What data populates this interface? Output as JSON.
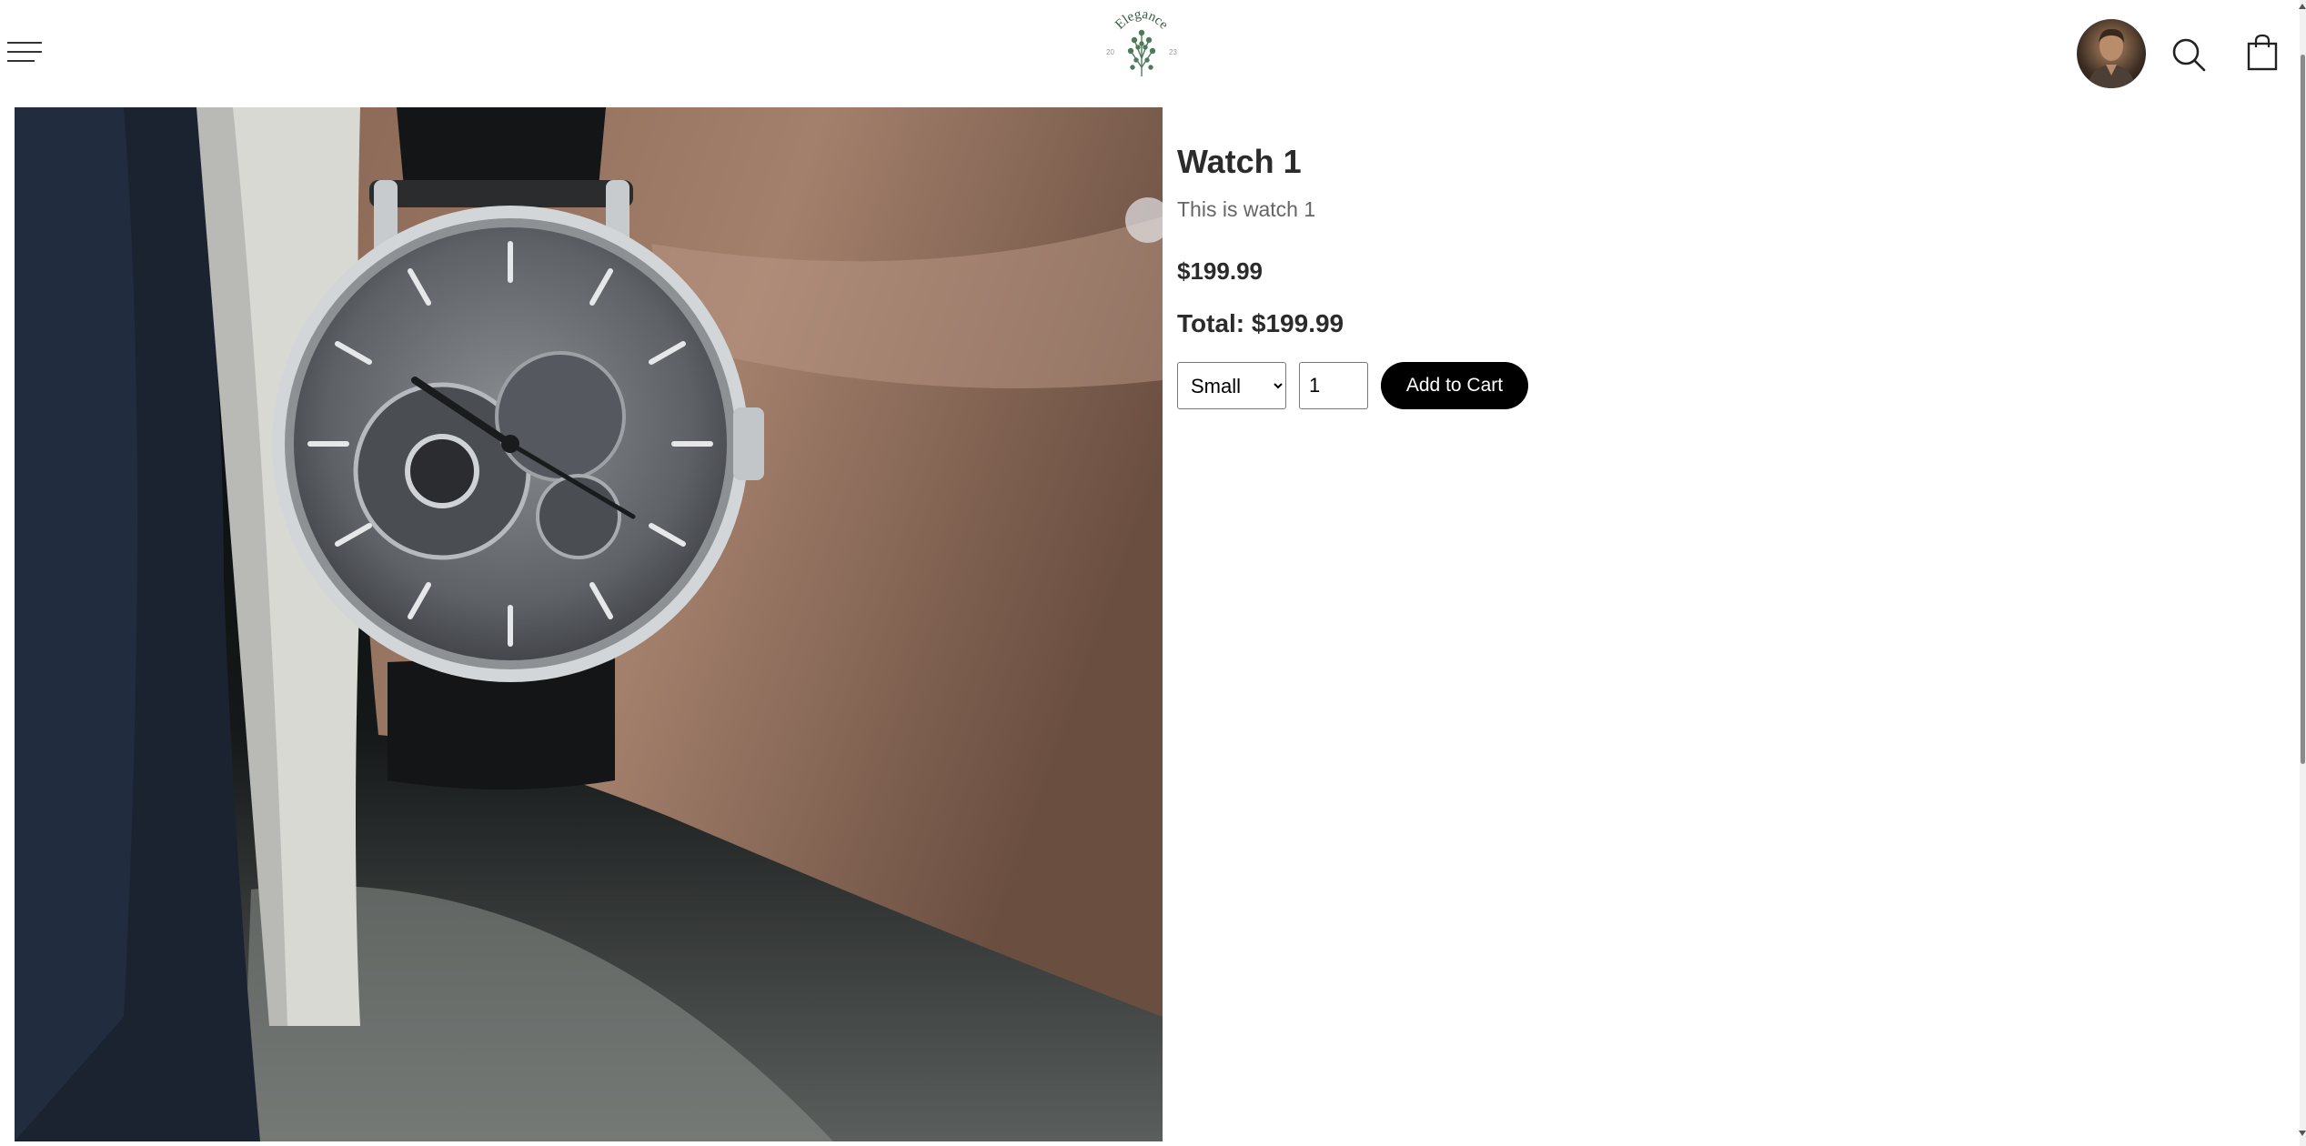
{
  "header": {
    "logo_text": "Elegance",
    "logo_year_left": "20",
    "logo_year_right": "23",
    "menu_icon": "hamburger-menu-icon",
    "search_icon": "search-icon",
    "cart_icon": "shopping-bag-icon"
  },
  "product": {
    "title": "Watch 1",
    "description": "This is watch 1",
    "price": "$199.99",
    "total": "Total: $199.99",
    "size_options": [
      "Small"
    ],
    "selected_size": "Small",
    "quantity": "1",
    "add_to_cart_label": "Add to Cart"
  },
  "colors": {
    "button_bg": "#000000",
    "button_text": "#ffffff",
    "logo_green": "#4f7a5a"
  }
}
